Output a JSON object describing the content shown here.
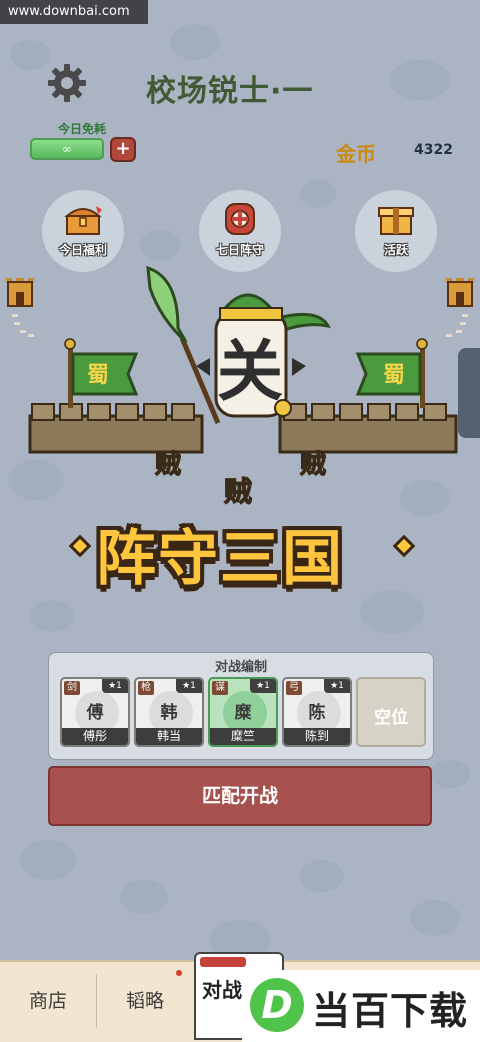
{
  "watermark": {
    "url": "www.downbai.com"
  },
  "header": {
    "title": "校场锐士·一"
  },
  "energy": {
    "label": "今日免耗",
    "plus": "+"
  },
  "currency": {
    "label": "金币",
    "value": "4322"
  },
  "features": [
    {
      "label": "今日福利",
      "icon": "treasure-chest-icon"
    },
    {
      "label": "七日阵守",
      "icon": "target-shield-icon"
    },
    {
      "label": "活跃",
      "icon": "gift-box-icon"
    }
  ],
  "hero": {
    "banner_left": "蜀",
    "banner_right": "蜀",
    "face_char": "关",
    "enemy_char": "贼"
  },
  "logo": {
    "title": "阵守三国"
  },
  "formation": {
    "title": "对战编制",
    "slots": [
      {
        "type": "剑",
        "glyph": "傅",
        "stars": "★1",
        "name": "傅彤",
        "selected": false
      },
      {
        "type": "枪",
        "glyph": "韩",
        "stars": "★1",
        "name": "韩当",
        "selected": false
      },
      {
        "type": "谋",
        "glyph": "糜",
        "stars": "★1",
        "name": "糜竺",
        "selected": true
      },
      {
        "type": "弓",
        "glyph": "陈",
        "stars": "★1",
        "name": "陈到",
        "selected": false
      }
    ],
    "empty_label": "空位"
  },
  "start_button": {
    "label": "匹配开战"
  },
  "bottom_nav": {
    "items": [
      "商店",
      "韬略"
    ],
    "active": "对战"
  },
  "download_badge": {
    "logo": "D",
    "text": "当百下载"
  },
  "colors": {
    "background": "#aab4c2",
    "gold": "#c88a10",
    "start_button": "#a6514d",
    "logo_yellow": "#ffc63d",
    "hero_green": "#4a9a3e"
  }
}
